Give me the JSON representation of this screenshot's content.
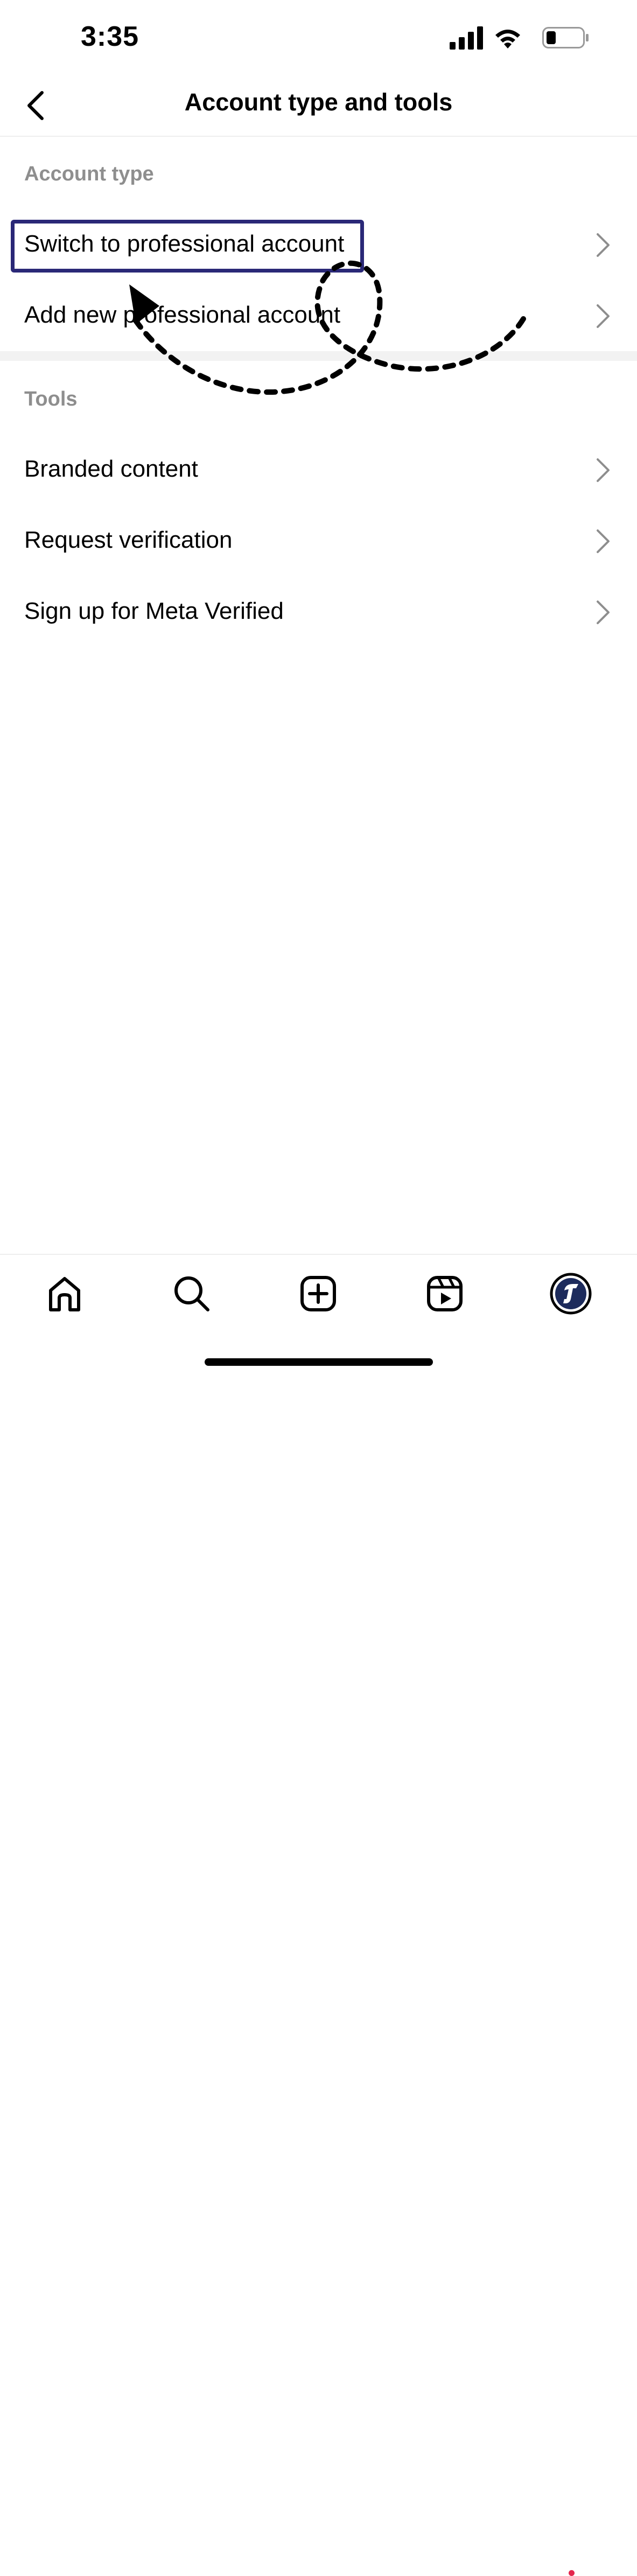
{
  "status_bar": {
    "time": "3:35",
    "icons": [
      "cellular-signal-icon",
      "wifi-icon",
      "battery-icon"
    ]
  },
  "header": {
    "title": "Account type and tools",
    "back_icon": "chevron-left-icon"
  },
  "sections": {
    "account_type": {
      "header": "Account type",
      "items": [
        {
          "label": "Switch to professional account",
          "highlighted": true
        },
        {
          "label": "Add new professional account",
          "highlighted": false
        }
      ]
    },
    "tools": {
      "header": "Tools",
      "items": [
        {
          "label": "Branded content"
        },
        {
          "label": "Request verification"
        },
        {
          "label": "Sign up for Meta Verified"
        }
      ]
    }
  },
  "tab_bar": {
    "tabs": [
      {
        "icon": "home-icon"
      },
      {
        "icon": "search-icon"
      },
      {
        "icon": "create-post-icon"
      },
      {
        "icon": "reels-icon"
      },
      {
        "icon": "profile-avatar-icon",
        "has_notification": true
      }
    ]
  },
  "colors": {
    "highlight_border": "#2a2877",
    "section_header": "#8e8e8e",
    "chevron": "#8e8e8e",
    "notification_dot": "#e4264d",
    "avatar_fill": "#1d2b5c"
  }
}
